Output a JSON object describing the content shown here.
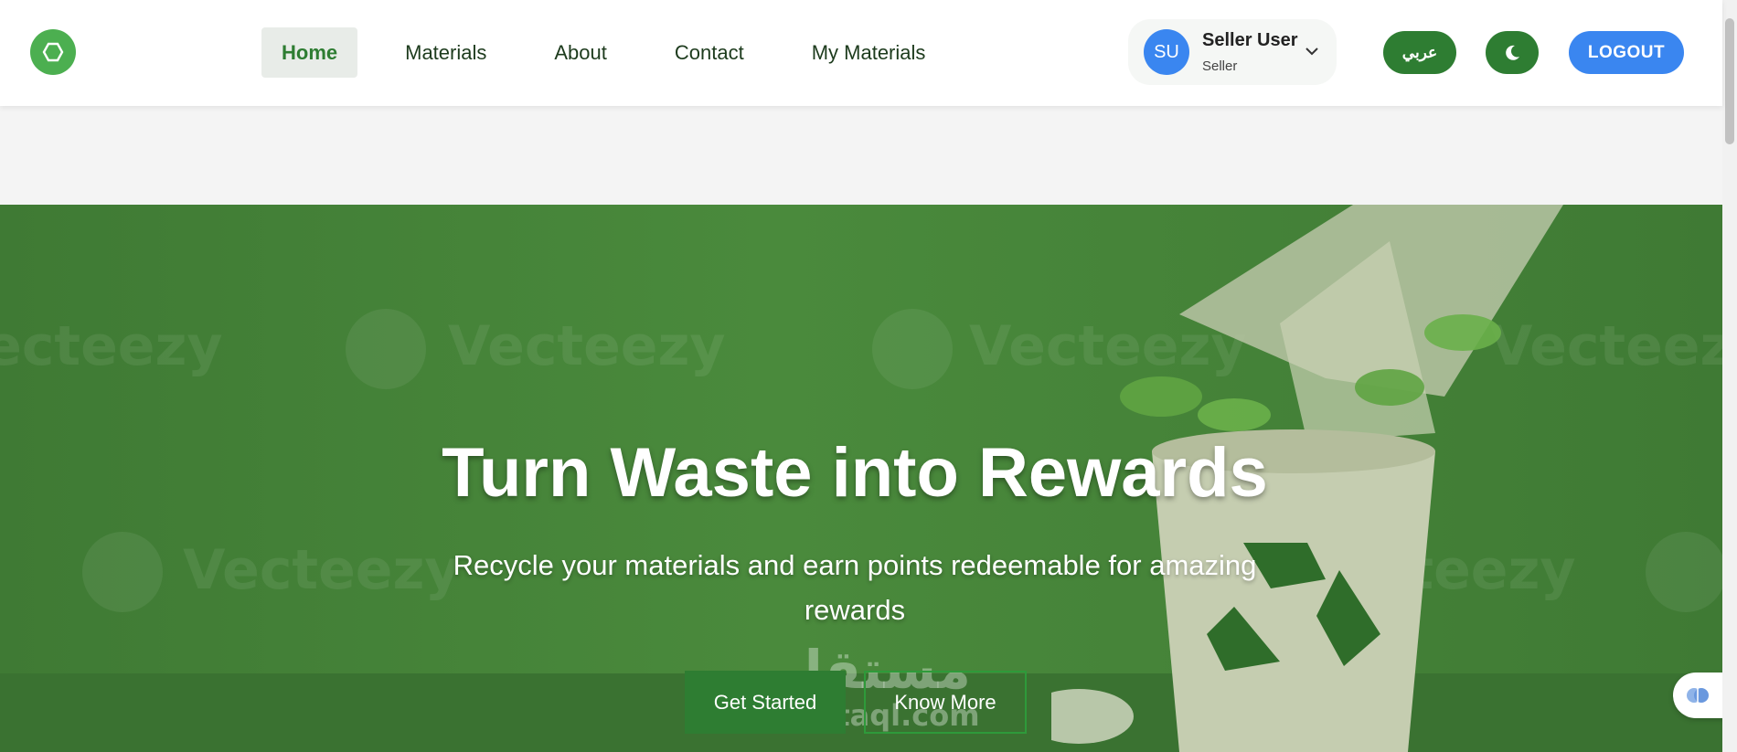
{
  "navbar": {
    "logo_icon": "hexagon-logo-icon",
    "links": [
      {
        "label": "Home",
        "active": true
      },
      {
        "label": "Materials",
        "active": false
      },
      {
        "label": "About",
        "active": false
      },
      {
        "label": "Contact",
        "active": false
      },
      {
        "label": "My Materials",
        "active": false
      }
    ],
    "user": {
      "initials": "SU",
      "name": "Seller User",
      "role": "Seller"
    },
    "language_button": "عربي",
    "theme_icon": "moon-icon",
    "logout_label": "LOGOUT"
  },
  "hero": {
    "title": "Turn Waste into Rewards",
    "subtitle": "Recycle your materials and earn points redeemable for amazing rewards",
    "primary_cta": "Get Started",
    "secondary_cta": "Know More",
    "watermark_text": "Vecteezy",
    "overlay_watermark_ar": "مستقل",
    "overlay_watermark_en": "mostaql.com"
  },
  "floating_widget_icon": "brain-icon",
  "colors": {
    "brand_green": "#2e7d32",
    "logo_green": "#4caf50",
    "accent_blue": "#3a86f0",
    "hero_green": "#4a8a3c"
  }
}
